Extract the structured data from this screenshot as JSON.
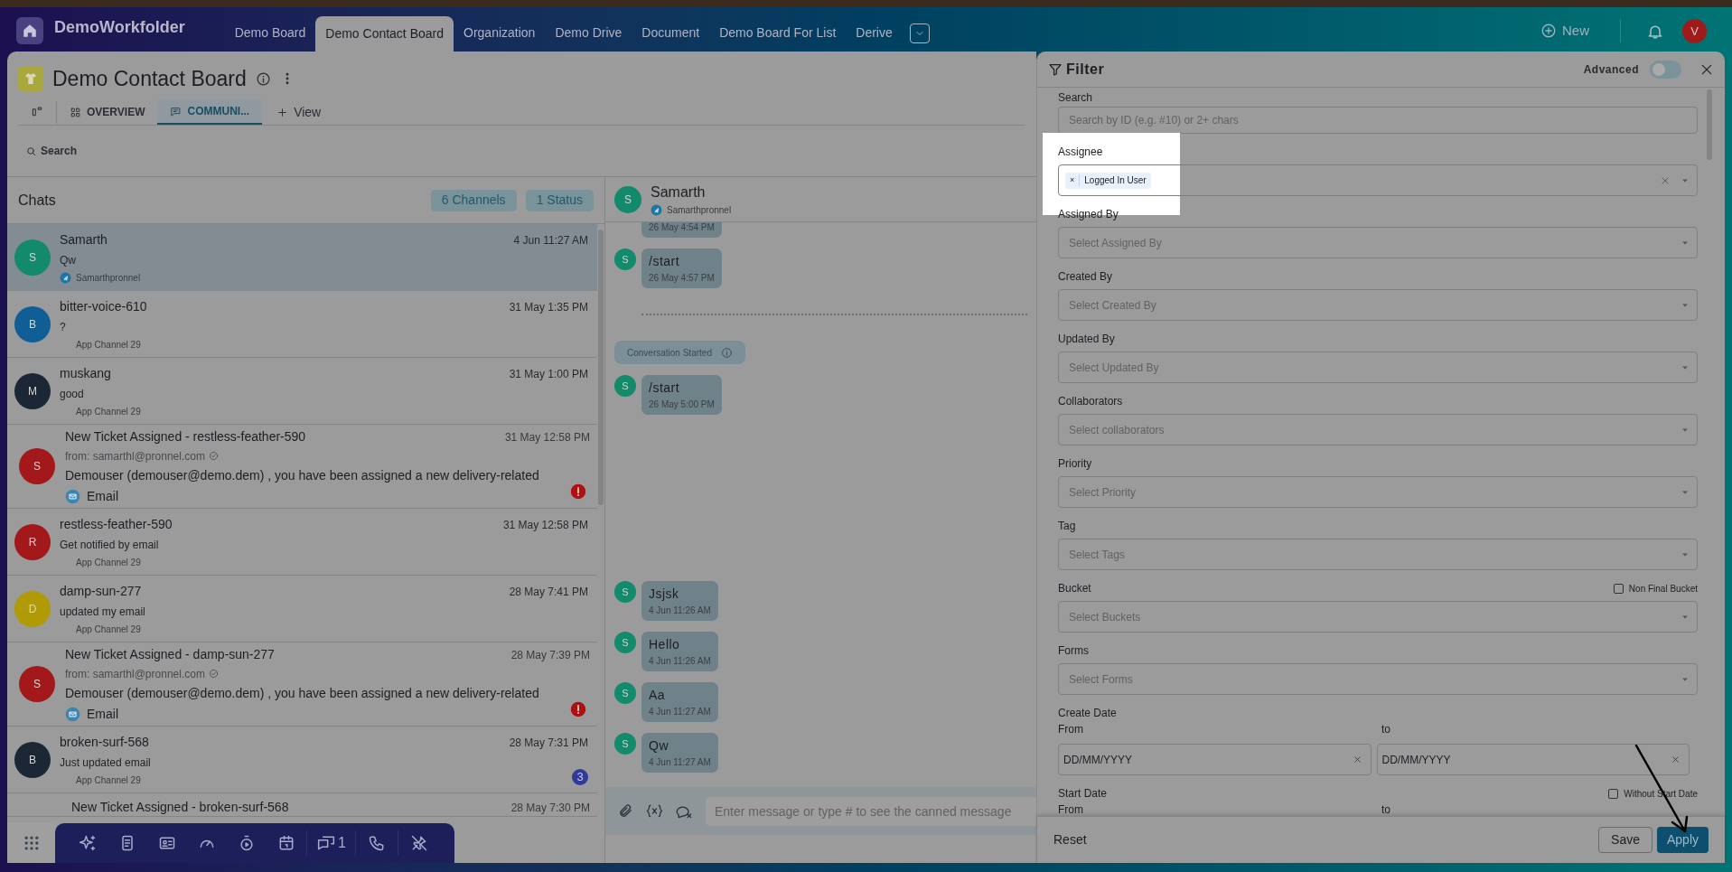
{
  "top_nav": {
    "workspace": "DemoWorkfolder",
    "tabs": [
      {
        "label": "Demo Board",
        "selected": false
      },
      {
        "label": "Demo Contact Board",
        "selected": true
      },
      {
        "label": "Organization",
        "selected": false
      },
      {
        "label": "Demo Drive",
        "selected": false
      },
      {
        "label": "Document",
        "selected": false
      },
      {
        "label": "Demo Board For List",
        "selected": false
      },
      {
        "label": "Derive",
        "selected": false
      }
    ],
    "new_label": "New",
    "avatar": "V"
  },
  "board": {
    "title": "Demo Contact Board",
    "views": [
      {
        "label": "OVERVIEW",
        "kind": "overview",
        "selected": false
      },
      {
        "label": "COMMUNI...",
        "kind": "chat",
        "selected": true
      }
    ],
    "add_view": "View",
    "search": "Search"
  },
  "chats": {
    "title": "Chats",
    "badges": [
      "6 Channels",
      "1 Status"
    ],
    "items": [
      {
        "kind": "chat",
        "avatar": "S",
        "color": "#138a6c",
        "name": "Samarth",
        "time": "4 Jun 11:27 AM",
        "preview": "Qw",
        "channel": "Samarthpronnel",
        "channel_icon": true,
        "selected": true
      },
      {
        "kind": "chat",
        "avatar": "B",
        "color": "#0f5e95",
        "name": "bitter-voice-610",
        "time": "31 May 1:35 PM",
        "preview": "?",
        "channel": "App Channel 29",
        "channel_icon": false,
        "selected": false
      },
      {
        "kind": "chat",
        "avatar": "M",
        "color": "#1c2735",
        "name": "muskang",
        "time": "31 May 1:00 PM",
        "preview": "good",
        "channel": "App Channel 29",
        "channel_icon": false,
        "selected": false
      },
      {
        "kind": "email",
        "avatar": "S",
        "color": "#a3181a",
        "name": "New Ticket Assigned - restless-feather-590",
        "time": "31 May 12:58 PM",
        "from": "from: samarthl@pronnel.com",
        "preview": "Demouser (demouser@demo.dem) , you have been assigned a new delivery-related",
        "channel": "Email",
        "alert": true,
        "selected": false
      },
      {
        "kind": "chat",
        "avatar": "R",
        "color": "#a3181a",
        "name": "restless-feather-590",
        "time": "31 May 12:58 PM",
        "preview": "Get notified by email",
        "channel": "App Channel 29",
        "channel_icon": false,
        "selected": false
      },
      {
        "kind": "chat",
        "avatar": "D",
        "color": "#b09a05",
        "name": "damp-sun-277",
        "time": "28 May 7:41 PM",
        "preview": "updated my email",
        "channel": "App Channel 29",
        "channel_icon": false,
        "selected": false
      },
      {
        "kind": "email",
        "avatar": "S",
        "color": "#a3181a",
        "name": "New Ticket Assigned - damp-sun-277",
        "time": "28 May 7:39 PM",
        "from": "from: samarthl@pronnel.com",
        "preview": "Demouser (demouser@demo.dem) , you have been assigned a new delivery-related",
        "channel": "Email",
        "alert": true,
        "selected": false
      },
      {
        "kind": "chat",
        "avatar": "B",
        "color": "#1c2735",
        "name": "broken-surf-568",
        "time": "28 May 7:31 PM",
        "preview": "Just updated email",
        "channel": "App Channel 29",
        "channel_icon": false,
        "unread": "3",
        "selected": false
      },
      {
        "kind": "email_cut",
        "name": "New Ticket Assigned - broken-surf-568",
        "time": "28 May 7:30 PM",
        "selected": false
      }
    ]
  },
  "conversation": {
    "name": "Samarth",
    "avatar": "S",
    "handle": "Samarthpronnel",
    "earlier": [
      {
        "kind": "time_only",
        "time": "26 May 4:54 PM"
      },
      {
        "kind": "message",
        "avatar": "S",
        "text": "/start",
        "time": "26 May 4:57 PM"
      },
      {
        "kind": "divider"
      },
      {
        "kind": "event",
        "text": "Conversation Started"
      },
      {
        "kind": "message",
        "avatar": "S",
        "text": "/start",
        "time": "26 May 5:00 PM"
      }
    ],
    "latest": [
      {
        "kind": "message",
        "avatar": "S",
        "text": "Jsjsk",
        "time": "4 Jun 11:26 AM"
      },
      {
        "kind": "message",
        "avatar": "S",
        "text": "Hello",
        "time": "4 Jun 11:26 AM"
      },
      {
        "kind": "message",
        "avatar": "S",
        "text": "Aa",
        "time": "4 Jun 11:27 AM"
      },
      {
        "kind": "message",
        "avatar": "S",
        "text": "Qw",
        "time": "4 Jun 11:27 AM"
      }
    ],
    "input_placeholder": "Enter message or type # to see the canned message"
  },
  "dock": {
    "chat_count": "1"
  },
  "filter": {
    "title": "Filter",
    "advanced_label": "Advanced",
    "advanced_on": false,
    "fields": [
      {
        "kind": "text",
        "label": "Search",
        "placeholder": "Search by ID (e.g. #10) or 2+ chars",
        "highlighted": false
      },
      {
        "kind": "select",
        "label": "Assignee",
        "tags": [
          {
            "remove": "×",
            "label": "Logged In User"
          }
        ],
        "highlighted": true
      },
      {
        "kind": "select",
        "label": "Assigned By",
        "placeholder": "Select Assigned By",
        "highlighted": false
      },
      {
        "kind": "select",
        "label": "Created By",
        "placeholder": "Select Created By",
        "highlighted": false
      },
      {
        "kind": "select",
        "label": "Updated By",
        "placeholder": "Select Updated By",
        "highlighted": false
      },
      {
        "kind": "select",
        "label": "Collaborators",
        "placeholder": "Select collaborators",
        "highlighted": false
      },
      {
        "kind": "select",
        "label": "Priority",
        "placeholder": "Select Priority",
        "highlighted": false
      },
      {
        "kind": "select",
        "label": "Tag",
        "placeholder": "Select Tags",
        "highlighted": false
      },
      {
        "kind": "select",
        "label": "Bucket",
        "placeholder": "Select Buckets",
        "option": {
          "label": "Non Final Bucket",
          "checked": false
        },
        "highlighted": false
      },
      {
        "kind": "select",
        "label": "Forms",
        "placeholder": "Select Forms",
        "highlighted": false
      },
      {
        "kind": "date_range",
        "label": "Create Date",
        "from_label": "From",
        "to_label": "to",
        "from_placeholder": "DD/MM/YYYY",
        "to_placeholder": "DD/MM/YYYY",
        "highlighted": false
      },
      {
        "kind": "date_range",
        "label": "Start Date",
        "option": {
          "label": "Without Start Date",
          "checked": false
        },
        "from_label": "From",
        "to_label": "to",
        "highlighted": false
      }
    ],
    "reset": "Reset",
    "save": "Save",
    "apply": "Apply"
  }
}
